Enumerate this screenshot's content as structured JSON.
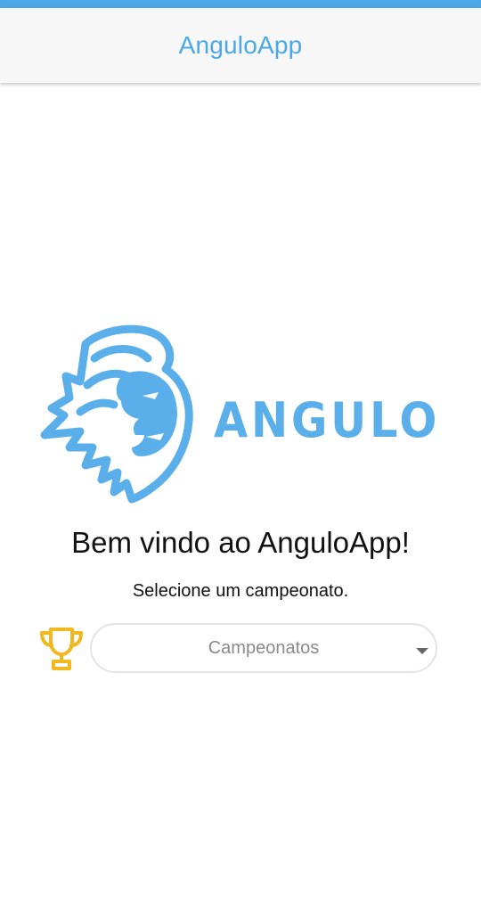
{
  "header": {
    "title": "AnguloApp"
  },
  "logo": {
    "wordmark": "ANGULO",
    "icon": "lion-head-icon",
    "color": "#5aaeea"
  },
  "welcome": {
    "heading": "Bem vindo ao AnguloApp!",
    "subtitle": "Selecione um campeonato."
  },
  "championship_select": {
    "icon": "trophy-icon",
    "placeholder": "Campeonatos"
  },
  "colors": {
    "accent": "#4aa8e8",
    "trophy": "#f2b820"
  }
}
